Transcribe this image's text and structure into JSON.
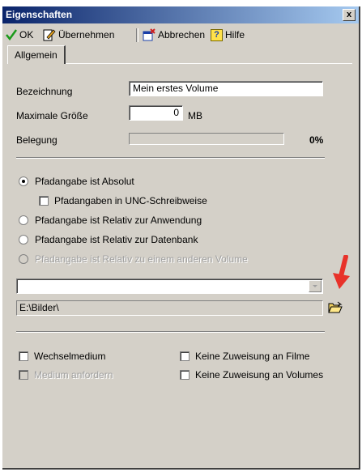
{
  "window": {
    "title": "Eigenschaften",
    "close_label": "x"
  },
  "toolbar": {
    "ok_label": "OK",
    "apply_label": "Übernehmen",
    "cancel_label": "Abbrechen",
    "help_label": "Hilfe",
    "help_icon_char": "?"
  },
  "tabs": [
    "Allgemein"
  ],
  "form": {
    "name_label": "Bezeichnung",
    "name_value": "Mein erstes Volume",
    "maxsize_label": "Maximale Größe",
    "maxsize_value": "0",
    "maxsize_unit": "MB",
    "usage_label": "Belegung",
    "usage_value": "0%"
  },
  "path_options": {
    "absolute": "Pfadangabe ist Absolut",
    "unc": "Pfadangaben in UNC-Schreibweise",
    "relative_app": "Pfadangabe ist Relativ zur Anwendung",
    "relative_db": "Pfadangabe ist Relativ zur Datenbank",
    "relative_volume": "Pfadangabe ist Relativ zu einem anderen Volume",
    "selected": "absolute"
  },
  "volume_select": {
    "value": ""
  },
  "path": {
    "value": "E:\\Bilder\\"
  },
  "options": {
    "removable": "Wechselmedium",
    "request_medium": "Medium anfordern",
    "no_assign_films": "Keine Zuweisung an Filme",
    "no_assign_volumes": "Keine Zuweisung an Volumes"
  },
  "colors": {
    "titlebar": "#0a246a",
    "dialog": "#d4d0c8",
    "annotation_arrow": "#e8322a"
  }
}
